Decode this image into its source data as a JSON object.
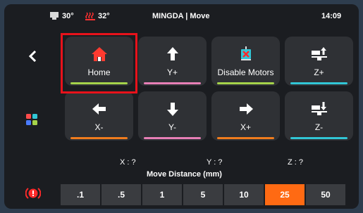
{
  "header": {
    "nozzle_temp": "30°",
    "bed_temp": "32°",
    "title": "MINGDA  | Move",
    "time": "14:09"
  },
  "tiles": [
    {
      "label": "Home",
      "icon": "home-icon"
    },
    {
      "label": "Y+",
      "icon": "arrow-up-icon"
    },
    {
      "label": "Disable Motors",
      "icon": "motor-off-icon"
    },
    {
      "label": "Z+",
      "icon": "z-up-icon"
    },
    {
      "label": "X-",
      "icon": "arrow-left-icon"
    },
    {
      "label": "Y-",
      "icon": "arrow-down-icon"
    },
    {
      "label": "X+",
      "icon": "arrow-right-icon"
    },
    {
      "label": "Z-",
      "icon": "z-down-icon"
    }
  ],
  "coords": {
    "x": "X : ?",
    "y": "Y : ?",
    "z": "Z : ?"
  },
  "move_distance": {
    "title": "Move Distance (mm)",
    "options": [
      ".1",
      ".5",
      "1",
      "5",
      "10",
      "25",
      "50"
    ],
    "selected": "25"
  },
  "colors": {
    "accent_selected": "#ff6a13",
    "highlight_box": "#e8121b",
    "home_icon": "#ff3b30",
    "bar_green": "#a5d34a",
    "bar_pink": "#e77fb6",
    "bar_cyan": "#31c6d6",
    "bar_orange": "#f07c1d"
  }
}
